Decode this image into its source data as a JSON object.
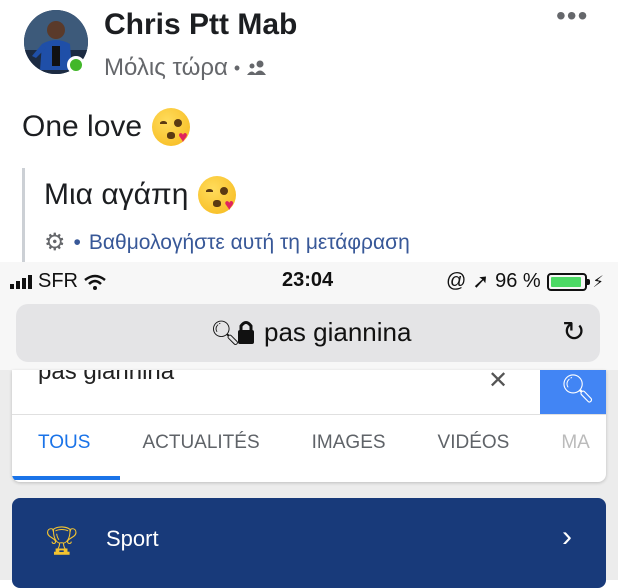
{
  "post": {
    "author": "Chris Ptt Mab",
    "time": "Μόλις τώρα",
    "privacy_icon": "friends-icon",
    "text": "One love",
    "emoji": "face-blowing-kiss",
    "translation": "Μια αγάπη",
    "rate_translation": "Βαθμολογήστε αυτή τη μετάφραση",
    "online_color": "#42b72a",
    "link_color": "#385898"
  },
  "status_bar": {
    "carrier": "SFR",
    "time": "23:04",
    "battery": "96 %",
    "battery_level": 0.96
  },
  "browser": {
    "url": "pas giannina"
  },
  "search": {
    "query": "pas giannina",
    "tabs": [
      "TOUS",
      "ACTUALITÉS",
      "IMAGES",
      "VIDÉOS",
      "MA"
    ],
    "active_tab": "TOUS",
    "accent_color": "#1a73e8"
  },
  "sport_card": {
    "label": "Sport",
    "bg_color": "#183a7a"
  }
}
